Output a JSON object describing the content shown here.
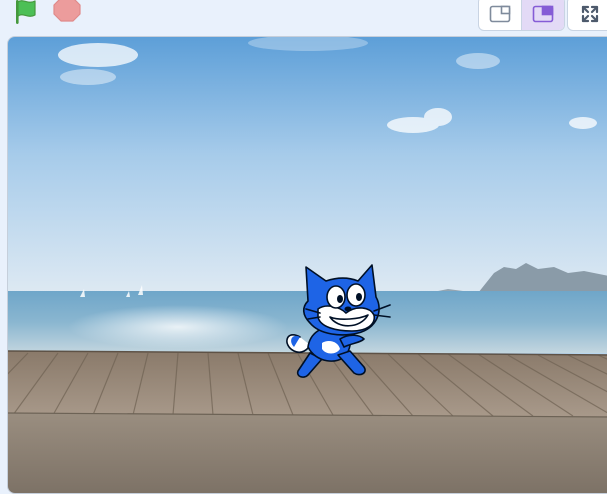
{
  "toolbar": {
    "green_flag_icon": "green-flag-icon",
    "stop_icon": "stop-sign-icon",
    "layout_buttons": [
      {
        "icon": "small-stage-icon",
        "active": false
      },
      {
        "icon": "normal-stage-icon",
        "active": true
      }
    ],
    "fullscreen_icon": "fullscreen-icon"
  },
  "stage": {
    "backdrop": "beach-boardwalk",
    "sprite": "scratch-cat"
  },
  "colors": {
    "accent": "#855cd6",
    "flag_green": "#4cbf56",
    "stop_red": "#ec9c9c",
    "toolbar_bg": "#e9f1fc",
    "sprite_blue": "#1e64e6"
  }
}
